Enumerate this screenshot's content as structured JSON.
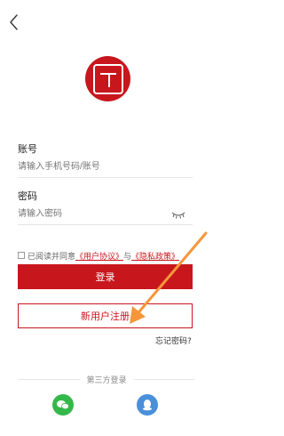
{
  "colors": {
    "brand_red": "#c8161d",
    "annotation_orange": "#f5963b",
    "wechat_green": "#35b84a",
    "qq_blue": "#4a8fd9"
  },
  "icons": {
    "back": "chevron-left-icon",
    "logo": "seal-logo-icon",
    "password_visibility": "eye-closed-icon",
    "wechat": "wechat-icon",
    "qq": "qq-icon"
  },
  "form": {
    "account_label": "账号",
    "account_placeholder": "请输入手机号码/账号",
    "password_label": "密码",
    "password_placeholder": "请输入密码"
  },
  "agreement": {
    "prefix": "已阅读并同意",
    "user_agreement": "《用户协议》",
    "and": "与",
    "privacy_policy": "《隐私政策》"
  },
  "buttons": {
    "login": "登录",
    "register": "新用户注册"
  },
  "forgot_password": "忘记密码?",
  "third_party": {
    "label": "第三方登录"
  }
}
